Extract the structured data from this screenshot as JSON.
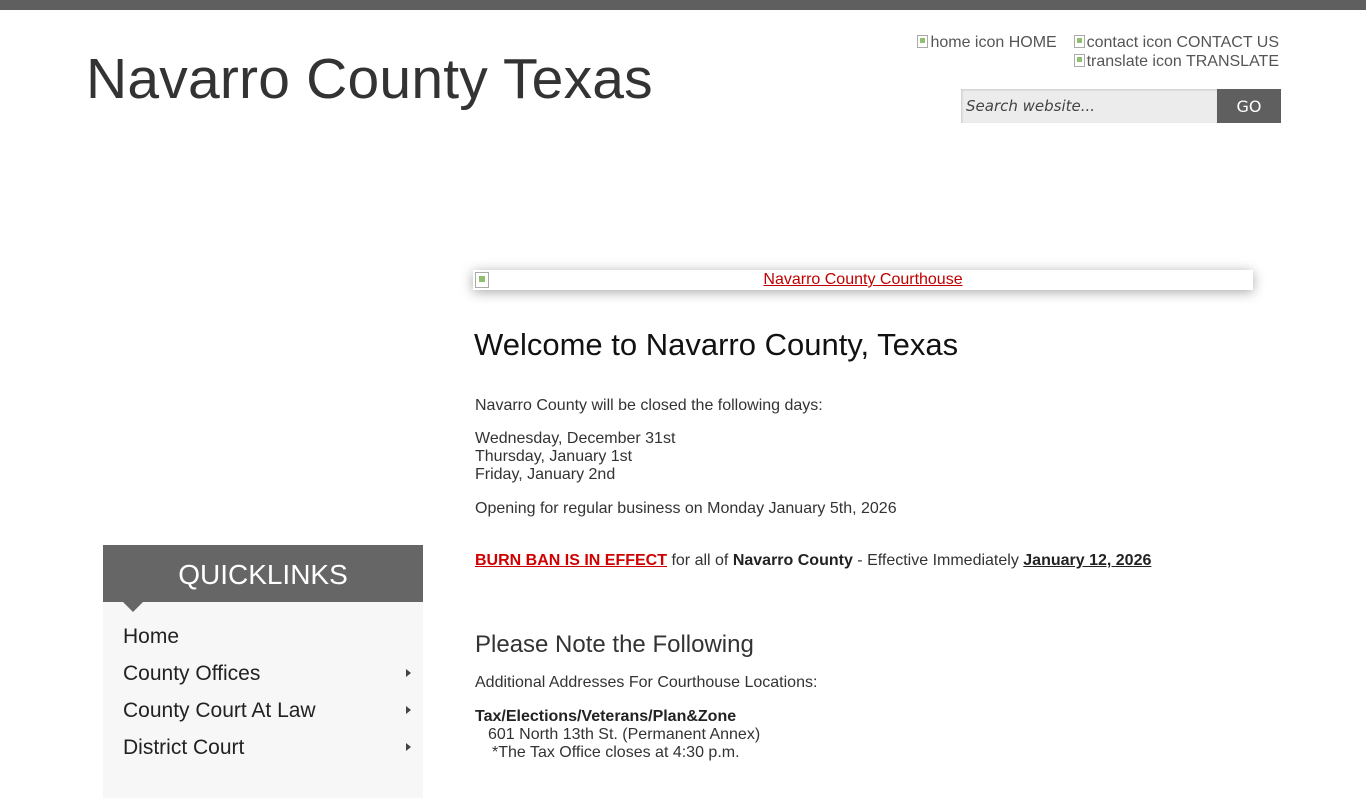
{
  "site": {
    "title": "Navarro County Texas"
  },
  "utility_links": {
    "home": {
      "icon_alt": "home icon",
      "label": "HOME"
    },
    "contact": {
      "icon_alt": "contact icon",
      "label": "CONTACT US"
    },
    "translate": {
      "icon_alt": "translate icon",
      "label": "TRANSLATE"
    }
  },
  "search": {
    "placeholder": "Search website...",
    "button_label": "GO"
  },
  "banner": {
    "link_text": "Navarro County Courthouse"
  },
  "main": {
    "welcome_heading": "Welcome to Navarro County, Texas",
    "closed_intro": "Navarro County will be closed the following days:",
    "closed_days": [
      "Wednesday, December 31st",
      "Thursday, January 1st",
      "Friday, January 2nd"
    ],
    "reopening": "Opening for regular business on Monday January 5th, 2026",
    "burn_ban": {
      "link": "BURN BAN IS IN EFFECT",
      "text1": " for all of ",
      "county": "Navarro County",
      "text2": " - Effective Immediately ",
      "date": "January 12, 2026"
    },
    "note_heading": "Please Note the Following",
    "addresses_intro": "Additional Addresses For Courthouse Locations:",
    "location_title": "Tax/Elections/Veterans/Plan&Zone",
    "location_address": "601 North 13th St. (Permanent Annex)",
    "location_note": "*The Tax Office closes at 4:30 p.m."
  },
  "quicklinks": {
    "title": "QUICKLINKS",
    "items": [
      {
        "label": "Home",
        "has_submenu": false
      },
      {
        "label": "County Offices",
        "has_submenu": true
      },
      {
        "label": "County Court At Law",
        "has_submenu": true
      },
      {
        "label": "District Court",
        "has_submenu": true
      }
    ]
  },
  "colors": {
    "top_bar": "#5f5f5f",
    "link_red": "#c00000",
    "burn_ban_red": "#d00000",
    "quicklinks_header": "#666666"
  }
}
